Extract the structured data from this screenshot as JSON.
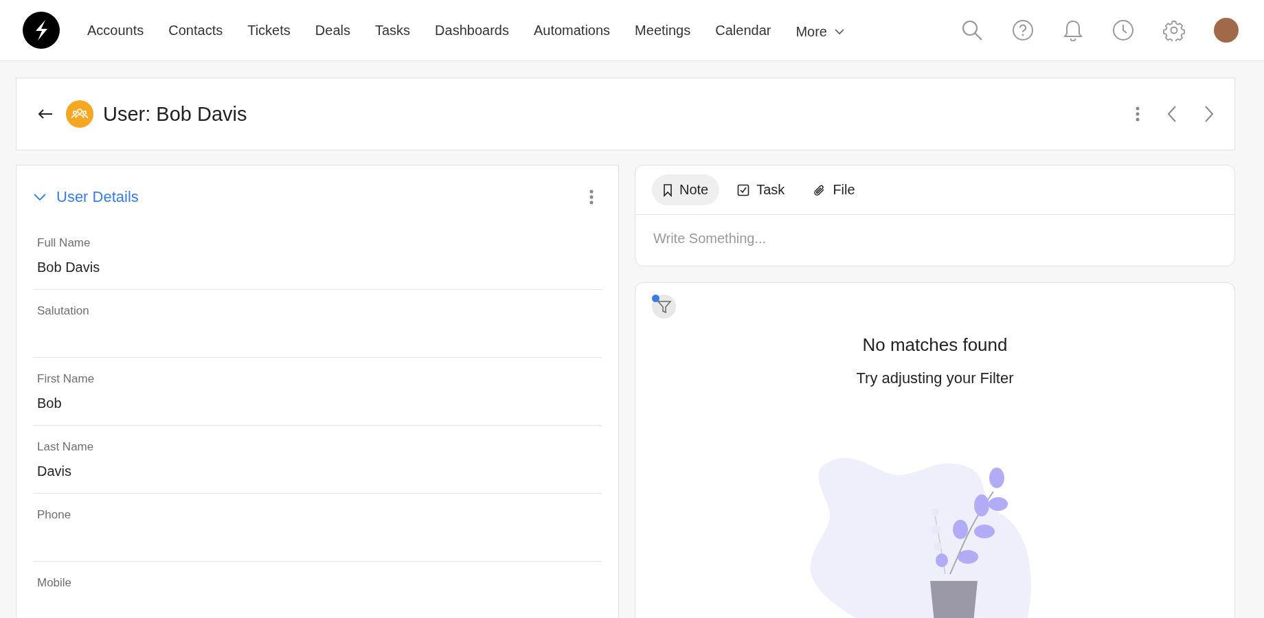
{
  "nav": {
    "items": [
      "Accounts",
      "Contacts",
      "Tickets",
      "Deals",
      "Tasks",
      "Dashboards",
      "Automations",
      "Meetings",
      "Calendar"
    ],
    "more": "More"
  },
  "header": {
    "title": "User: Bob Davis"
  },
  "details": {
    "title": "User Details",
    "expanded": true,
    "fields": [
      {
        "label": "Full Name",
        "value": "Bob Davis"
      },
      {
        "label": "Salutation"
      },
      {
        "label": "First Name",
        "value": "Bob"
      },
      {
        "label": "Last Name",
        "value": "Davis"
      },
      {
        "label": "Phone"
      },
      {
        "label": "Mobile"
      }
    ]
  },
  "composer": {
    "tabs": [
      {
        "label": "Note",
        "kind": "note",
        "selected": true
      },
      {
        "label": "Task",
        "kind": "task",
        "selected": false
      },
      {
        "label": "File",
        "kind": "file",
        "selected": false
      }
    ],
    "placeholder": "Write Something..."
  },
  "timeline": {
    "filter_active": true,
    "empty_title": "No matches found",
    "empty_hint": "Try adjusting your Filter"
  }
}
